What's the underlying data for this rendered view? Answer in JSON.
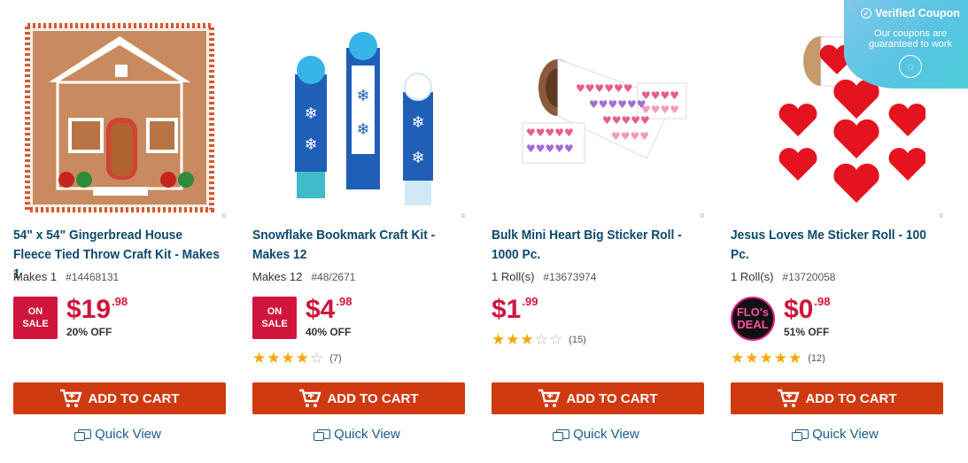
{
  "products": [
    {
      "title": "54\" x 54\" Gingerbread House Fleece Tied Throw Craft Kit - Makes 1",
      "quantity": "Makes 1",
      "sku": "#14468131",
      "badge": {
        "type": "sale",
        "line1": "ON",
        "line2": "SALE"
      },
      "price_dollars": "$19",
      "price_cents": ".98",
      "percent_off": "20% OFF",
      "rating": null,
      "add_to_cart": "ADD TO CART",
      "quick_view": "Quick View",
      "image_icon": "gingerbread-house-blanket-image"
    },
    {
      "title": "Snowflake Bookmark Craft Kit - Makes 12",
      "quantity": "Makes 12",
      "sku": "#48/2671",
      "badge": {
        "type": "sale",
        "line1": "ON",
        "line2": "SALE"
      },
      "price_dollars": "$4",
      "price_cents": ".98",
      "percent_off": "40% OFF",
      "rating": {
        "stars": 4,
        "count": "(7)"
      },
      "add_to_cart": "ADD TO CART",
      "quick_view": "Quick View",
      "image_icon": "snowflake-bookmarks-image"
    },
    {
      "title": "Bulk Mini Heart Big Sticker Roll - 1000 Pc.",
      "quantity": "1 Roll(s)",
      "sku": "#13673974",
      "badge": null,
      "price_dollars": "$1",
      "price_cents": ".99",
      "percent_off": "",
      "rating": {
        "stars": 3,
        "count": "(15)"
      },
      "add_to_cart": "ADD TO CART",
      "quick_view": "Quick View",
      "image_icon": "heart-sticker-roll-image"
    },
    {
      "title": "Jesus Loves Me Sticker Roll - 100 Pc.",
      "quantity": "1 Roll(s)",
      "sku": "#13720058",
      "badge": {
        "type": "flo",
        "line1": "FLO's",
        "line2": "DEAL"
      },
      "price_dollars": "$0",
      "price_cents": ".98",
      "percent_off": "51% OFF",
      "rating": {
        "stars": 5,
        "count": "(12)"
      },
      "add_to_cart": "ADD TO CART",
      "quick_view": "Quick View",
      "image_icon": "jesus-sticker-roll-image"
    }
  ],
  "coupon": {
    "title": "Verified Coupon",
    "subtitle": "Our coupons are guaranteed to work"
  },
  "colors": {
    "title_blue": "#0b4a6e",
    "price_red": "#d0153c",
    "cart_orange": "#d03a10",
    "star_gold": "#f2a900",
    "coupon_teal": "#56c4e2"
  }
}
